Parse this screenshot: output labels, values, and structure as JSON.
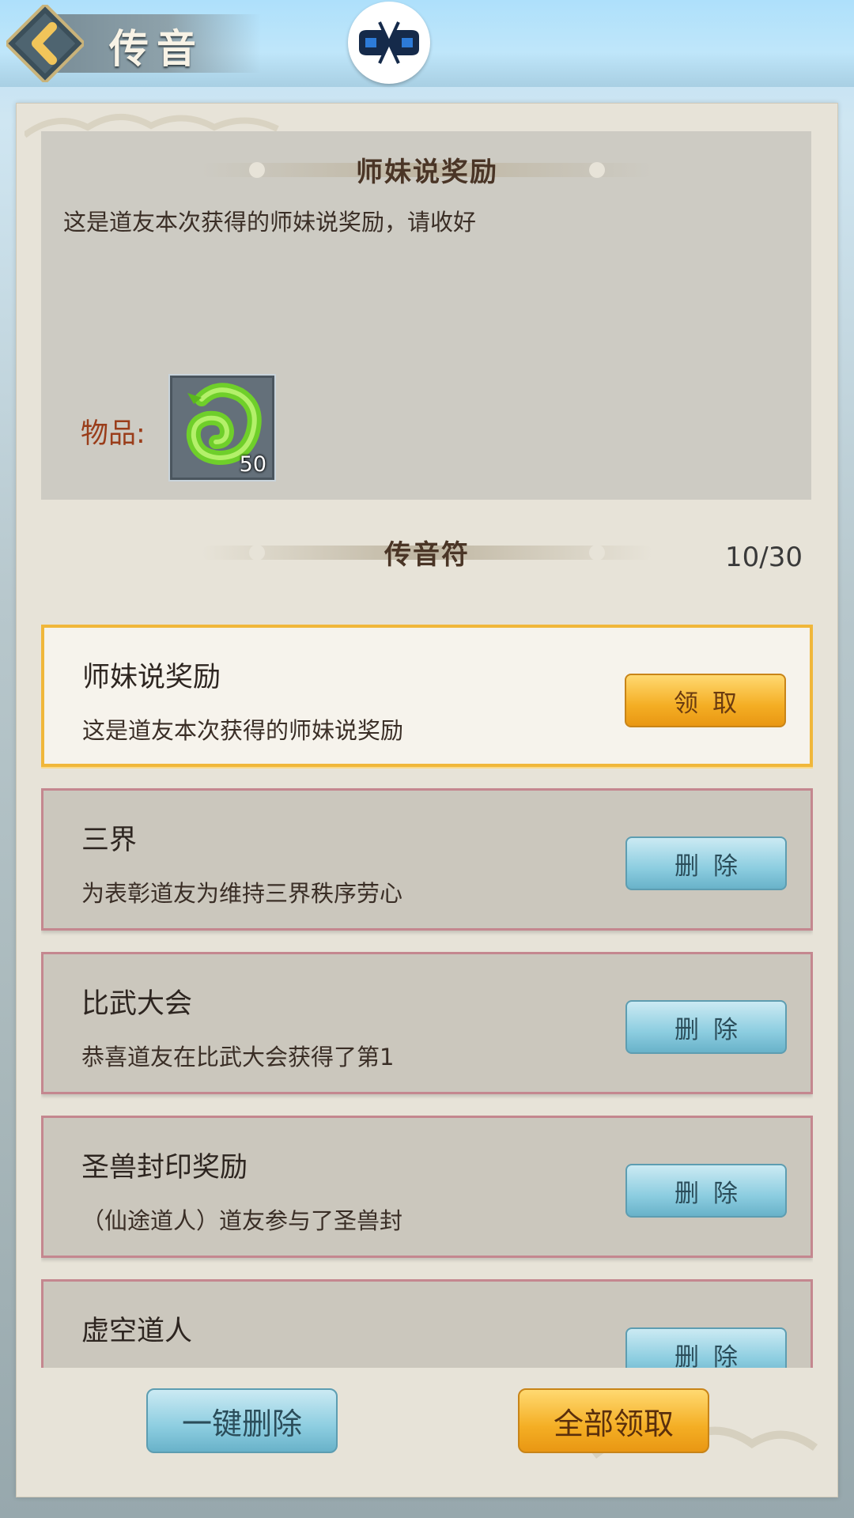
{
  "header": {
    "title": "传音",
    "back_icon": "chevron-left-icon",
    "logo_icon": "game-controller-icon"
  },
  "detail": {
    "heading": "师妹说奖励",
    "text": "这是道友本次获得的师妹说奖励，请收好",
    "items_label": "物品:",
    "item": {
      "icon": "jade-dragon-icon",
      "count": "50"
    }
  },
  "list_section": {
    "heading": "传音符",
    "counter": "10/30"
  },
  "mails": [
    {
      "title": "师妹说奖励",
      "desc": "这是道友本次获得的师妹说奖励",
      "button": "领取",
      "active": true
    },
    {
      "title": "三界",
      "desc": "为表彰道友为维持三界秩序劳心",
      "button": "删除",
      "active": false
    },
    {
      "title": "比武大会",
      "desc": "恭喜道友在比武大会获得了第1",
      "button": "删除",
      "active": false
    },
    {
      "title": "圣兽封印奖励",
      "desc": "（仙途道人）道友参与了圣兽封",
      "button": "删除",
      "active": false
    },
    {
      "title": "虚空道人",
      "desc": "",
      "button": "删除",
      "active": false
    }
  ],
  "footer": {
    "delete_all": "一键删除",
    "claim_all": "全部领取"
  },
  "colors": {
    "gold": "#f4ae24",
    "blue": "#8ccde0",
    "row_border": "#c4878f",
    "active_border": "#f0b73a"
  }
}
